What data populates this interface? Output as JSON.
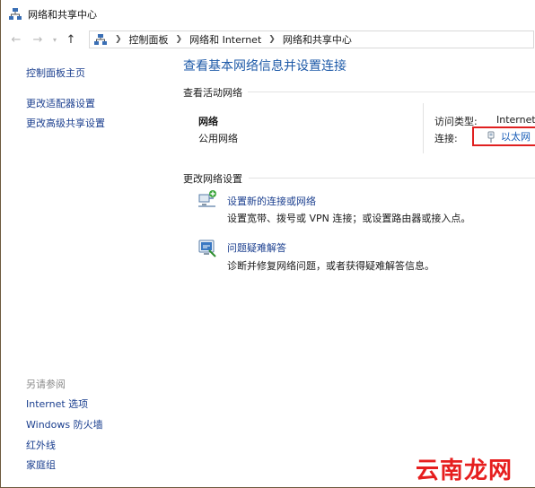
{
  "window": {
    "title": "网络和共享中心"
  },
  "address": {
    "breadcrumbs": [
      "控制面板",
      "网络和 Internet",
      "网络和共享中心"
    ]
  },
  "sidebar": {
    "links": [
      "控制面板主页",
      "更改适配器设置",
      "更改高级共享设置"
    ],
    "see_also_heading": "另请参阅",
    "see_also": [
      "Internet 选项",
      "Windows 防火墙",
      "红外线",
      "家庭组"
    ]
  },
  "main": {
    "heading": "查看基本网络信息并设置连接",
    "active_section": "查看活动网络",
    "network": {
      "name": "网络",
      "type": "公用网络",
      "access_label": "访问类型:",
      "access_value": "Internet",
      "connection_label": "连接:",
      "connection_value": "以太网"
    },
    "change_section": "更改网络设置",
    "tasks": [
      {
        "title": "设置新的连接或网络",
        "desc": "设置宽带、拨号或 VPN 连接；或设置路由器或接入点。",
        "icon": "new-connection-icon"
      },
      {
        "title": "问题疑难解答",
        "desc": "诊断并修复网络问题，或者获得疑难解答信息。",
        "icon": "troubleshoot-icon"
      }
    ]
  },
  "watermark": "云南龙网",
  "colors": {
    "link": "#1b3f8f",
    "heading": "#1e5aa8",
    "highlight_box": "#e02020"
  }
}
